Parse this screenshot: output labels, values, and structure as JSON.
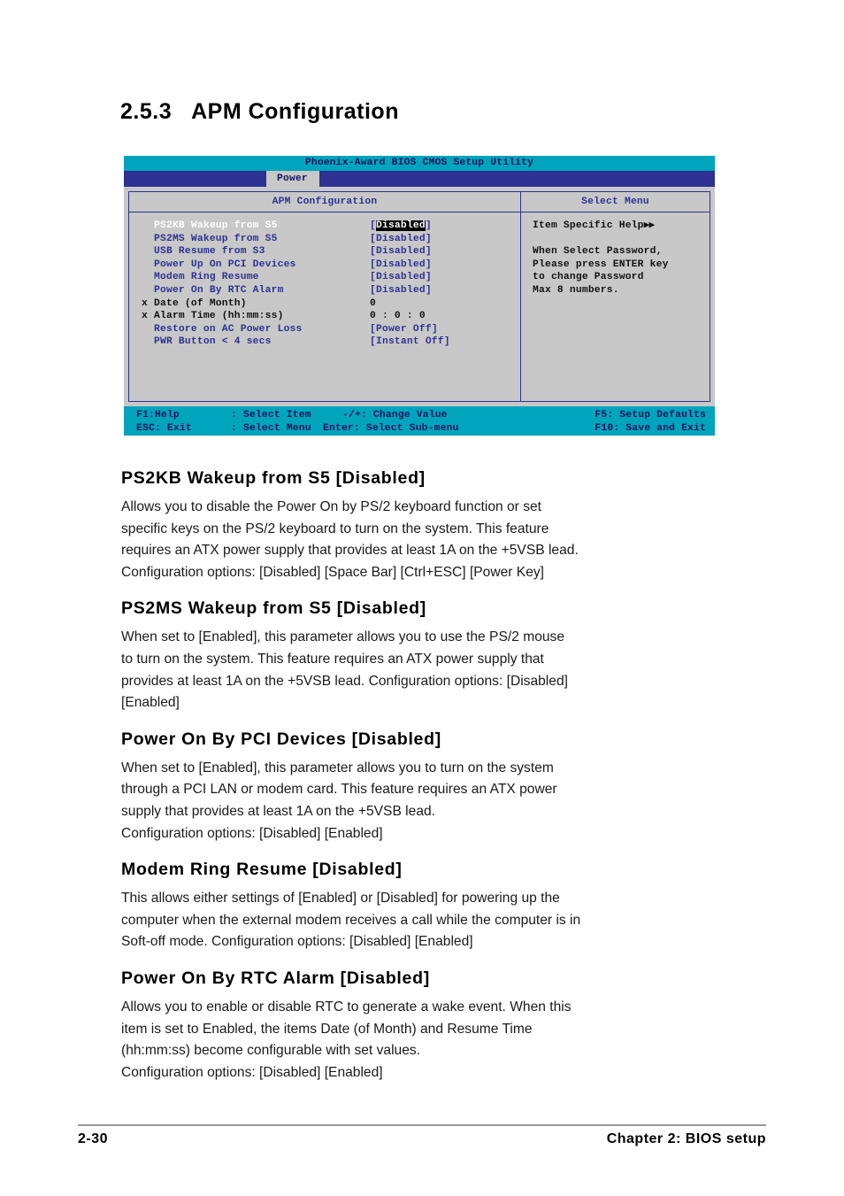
{
  "section": {
    "number": "2.5.3",
    "title": "APM Configuration"
  },
  "bios": {
    "title": "Phoenix-Award BIOS CMOS Setup Utility",
    "tab": "Power",
    "left_panel_heading": "APM Configuration",
    "right_panel_heading": "Select Menu",
    "rows": [
      {
        "mark": "",
        "label": "PS2KB Wakeup from S5",
        "value_open": "[",
        "value": "Disabled",
        "value_close": "]",
        "selected": true,
        "dim": false
      },
      {
        "mark": "",
        "label": "PS2MS Wakeup from S5",
        "value_open": "[",
        "value": "Disabled",
        "value_close": "]",
        "selected": false,
        "dim": false
      },
      {
        "mark": "",
        "label": "USB Resume from  S3",
        "value_open": "[",
        "value": "Disabled",
        "value_close": "]",
        "selected": false,
        "dim": false
      },
      {
        "mark": "",
        "label": "Power Up On PCI Devices",
        "value_open": "[",
        "value": "Disabled",
        "value_close": "]",
        "selected": false,
        "dim": false
      },
      {
        "mark": "",
        "label": "Modem Ring Resume",
        "value_open": "[",
        "value": "Disabled",
        "value_close": "]",
        "selected": false,
        "dim": false
      },
      {
        "mark": "",
        "label": "Power On By RTC Alarm",
        "value_open": "[",
        "value": "Disabled",
        "value_close": "]",
        "selected": false,
        "dim": false
      },
      {
        "mark": "x",
        "label": "Date (of Month)",
        "value_open": "",
        "value": "    0",
        "value_close": "",
        "selected": false,
        "dim": true
      },
      {
        "mark": "x",
        "label": "Alarm Time (hh:mm:ss)",
        "value_open": "",
        "value": "0 :  0 : 0",
        "value_close": "",
        "selected": false,
        "dim": true
      },
      {
        "mark": "",
        "label": "Restore on AC Power Loss",
        "value_open": "[",
        "value": "Power Off",
        "value_close": "]",
        "selected": false,
        "dim": false
      },
      {
        "mark": "",
        "label": "PWR Button < 4 secs",
        "value_open": "[",
        "value": "Instant Off",
        "value_close": "]",
        "selected": false,
        "dim": false
      }
    ],
    "help": {
      "title": "Item Specific Help",
      "arrows": "▶▶",
      "lines": [
        "When Select Password,",
        "Please press ENTER key",
        "to change Password",
        "Max 8 numbers."
      ]
    },
    "keybar": [
      {
        "c1": "F1:Help",
        "c2": ": Select Item",
        "c3": "-/+: Change Value",
        "c4": "F5: Setup Defaults"
      },
      {
        "c1": "ESC: Exit",
        "c2": ": Select Menu",
        "c3": "Enter: Select Sub-menu",
        "c4": "F10: Save and Exit"
      }
    ]
  },
  "sections": [
    {
      "heading": "PS2KB Wakeup from S5 [Disabled]",
      "lines": [
        "Allows you to disable the Power On by PS/2 keyboard function or set",
        "specific keys on the PS/2 keyboard to turn on the system. This feature",
        "requires an ATX power supply that provides at least 1A on the +5VSB lead.",
        "Configuration options: [Disabled] [Space Bar] [Ctrl+ESC] [Power Key]"
      ]
    },
    {
      "heading": "PS2MS Wakeup from S5 [Disabled]",
      "lines": [
        "When set to [Enabled], this parameter allows you to use the PS/2 mouse",
        "to turn on the system. This feature requires an ATX power supply that",
        "provides at least 1A on the +5VSB lead. Configuration options: [Disabled]",
        "[Enabled]"
      ]
    },
    {
      "heading": "Power On By PCI Devices [Disabled]",
      "lines": [
        "When set to [Enabled], this parameter allows you to turn on the system",
        "through a PCI LAN or modem card. This feature requires an ATX power",
        "supply that provides at least 1A on the +5VSB lead.",
        "Configuration options: [Disabled] [Enabled]"
      ]
    },
    {
      "heading": "Modem Ring Resume [Disabled]",
      "lines": [
        "This allows either settings of [Enabled] or [Disabled] for powering up the",
        "computer when the external modem receives a call while the computer is in",
        "Soft-off mode. Configuration options: [Disabled] [Enabled]"
      ]
    },
    {
      "heading": "Power On By RTC Alarm [Disabled]",
      "lines": [
        "Allows you to enable or disable RTC to generate a wake event. When this",
        "item is set to Enabled, the items Date (of Month) and Resume Time",
        "(hh:mm:ss) become configurable with set values.",
        "Configuration options: [Disabled] [Enabled]"
      ]
    }
  ],
  "footer": {
    "page": "2-30",
    "chapter": "Chapter 2: BIOS setup"
  },
  "colors": {
    "bios_title_bar": "#00a5bd",
    "bios_tab_bar": "#2e3192",
    "bios_panel_bg": "#c8c8c8",
    "bios_text_blue": "#2e3192",
    "bios_selected_bg": "#000000"
  }
}
